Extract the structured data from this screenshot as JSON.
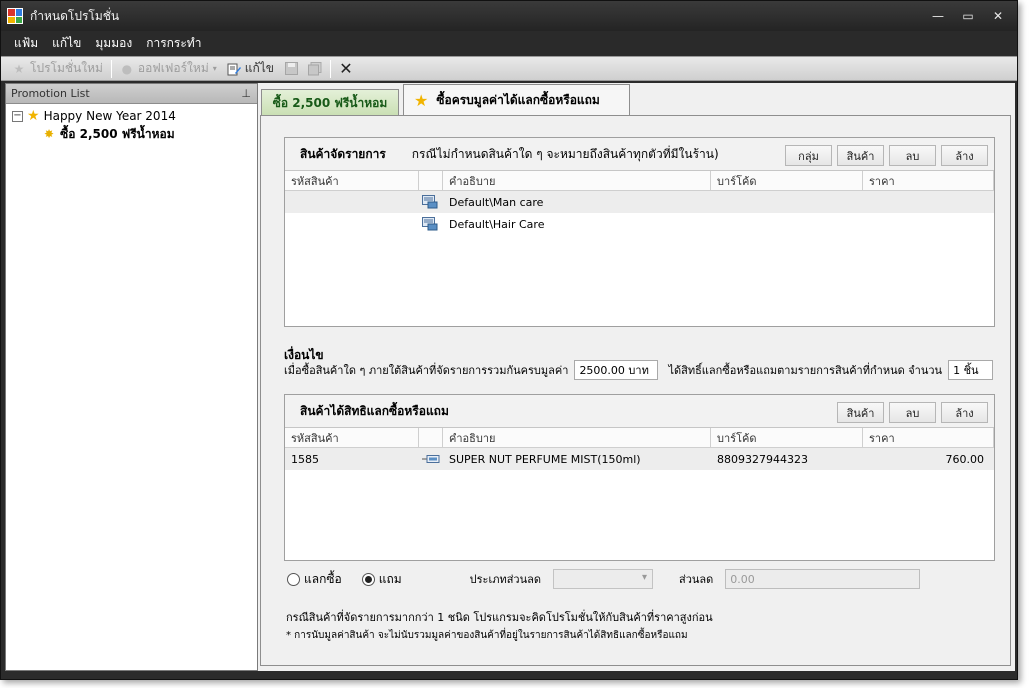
{
  "window": {
    "title": "กำหนดโปรโมชั่น"
  },
  "menu": [
    "แฟ้ม",
    "แก้ไข",
    "มุมมอง",
    "การกระทำ"
  ],
  "toolbar": {
    "new_promo": "โปรโมชั่นใหม่",
    "new_offer": "ออฟเฟอร์ใหม่",
    "edit": "แก้ไข"
  },
  "promotion_list": {
    "header": "Promotion List",
    "root": "Happy New Year 2014",
    "child": "ซื้อ 2,500 ฟรีน้ำหอม"
  },
  "tabs": [
    {
      "label": "ซื้อ 2,500 ฟรีน้ำหอม"
    },
    {
      "label": "ซื้อครบมูลค่าได้แลกซื้อหรือแถม"
    }
  ],
  "products_section": {
    "title": "สินค้าจัดรายการ",
    "note": "กรณีไม่กำหนดสินค้าใด ๆ จะหมายถึงสินค้าทุกตัวที่มีในร้าน)",
    "buttons": {
      "group": "กลุ่ม",
      "product": "สินค้า",
      "delete": "ลบ",
      "clear": "ล้าง"
    },
    "columns": [
      "รหัสสินค้า",
      "คำอธิบาย",
      "บาร์โค้ด",
      "ราคา"
    ],
    "rows": [
      {
        "code": "",
        "description": "Default\\Man care",
        "barcode": "",
        "price": ""
      },
      {
        "code": "",
        "description": "Default\\Hair Care",
        "barcode": "",
        "price": ""
      }
    ]
  },
  "condition": {
    "title": "เงื่อนไข",
    "text_before": "เมื่อซื้อสินค้าใด ๆ ภายใต้สินค้าที่จัดรายการรวมกันครบมูลค่า",
    "amount": "2500.00 บาท",
    "text_after": "ได้สิทธิ์แลกซื้อหรือแถมตามรายการสินค้าที่กำหนด จำนวน",
    "quantity": "1 ชิ้น"
  },
  "reward_section": {
    "title": "สินค้าได้สิทธิแลกซื้อหรือแถม",
    "buttons": {
      "product": "สินค้า",
      "delete": "ลบ",
      "clear": "ล้าง"
    },
    "columns": [
      "รหัสสินค้า",
      "คำอธิบาย",
      "บาร์โค้ด",
      "ราคา"
    ],
    "rows": [
      {
        "code": "1585",
        "description": "SUPER NUT PERFUME MIST(150ml)",
        "barcode": "8809327944323",
        "price": "760.00"
      }
    ]
  },
  "options": {
    "radio_exchange": "แลกซื้อ",
    "radio_free": "แถม",
    "selected": "แถม",
    "discount_type_label": "ประเภทส่วนลด",
    "discount_type_value": "",
    "discount_label": "ส่วนลด",
    "discount_value": "0.00"
  },
  "notes": {
    "line1": "กรณีสินค้าที่จัดรายการมากกว่า 1 ชนิด โปรแกรมจะคิดโปรโมชั่นให้กับสินค้าที่ราคาสูงก่อน",
    "line2": "* การนับมูลค่าสินค้า จะไม่นับรวมมูลค่าของสินค้าที่อยู่ในรายการสินค้าได้สิทธิแลกซื้อหรือแถม"
  }
}
